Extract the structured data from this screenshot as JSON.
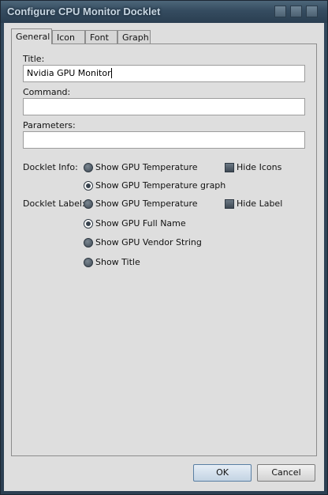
{
  "window": {
    "title": "Configure CPU Monitor Docklet"
  },
  "tabs": [
    {
      "label": "General",
      "active": true
    },
    {
      "label": "Icon",
      "active": false
    },
    {
      "label": "Font",
      "active": false
    },
    {
      "label": "Graph",
      "active": false
    }
  ],
  "form": {
    "title_label": "Title:",
    "title_value": "Nvidia GPU Monitor",
    "command_label": "Command:",
    "command_value": "",
    "parameters_label": "Parameters:",
    "parameters_value": ""
  },
  "docklet_info": {
    "label": "Docklet Info:",
    "options": [
      {
        "label": "Show GPU Temperature",
        "selected": false
      },
      {
        "label": "Show GPU Temperature graph",
        "selected": true
      }
    ],
    "hide_icons_label": "Hide Icons",
    "hide_icons_checked": false
  },
  "docklet_label": {
    "label": "Docklet Label:",
    "options": [
      {
        "label": "Show GPU Temperature",
        "selected": false
      },
      {
        "label": "Show GPU Full Name",
        "selected": true
      },
      {
        "label": "Show GPU Vendor String",
        "selected": false
      },
      {
        "label": "Show Title",
        "selected": false
      }
    ],
    "hide_label_label": "Hide Label",
    "hide_label_checked": false
  },
  "buttons": {
    "ok": "OK",
    "cancel": "Cancel"
  },
  "colors": {
    "titlebar": "#354c60",
    "title_text": "#c8d6e2",
    "client_bg": "#dedede",
    "radio_fill": "#3f4a55"
  }
}
